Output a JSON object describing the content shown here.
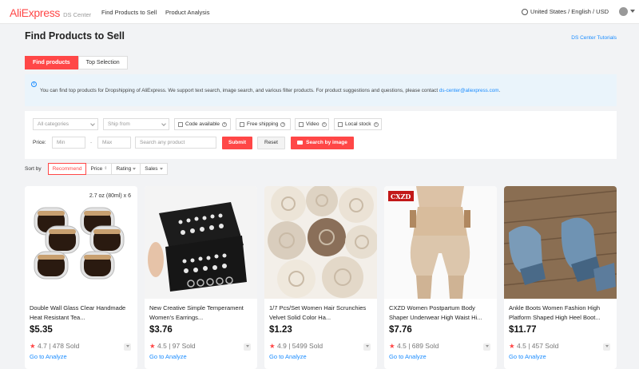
{
  "header": {
    "logo": "AliExpress",
    "logo_sub": "DS Center",
    "nav": [
      "Find Products to Sell",
      "Product Analysis"
    ],
    "locale": "United States / English / USD"
  },
  "page": {
    "title": "Find Products to Sell",
    "tutorials": "DS Center Tutorials"
  },
  "tabs": [
    {
      "label": "Find products",
      "active": true
    },
    {
      "label": "Top Selection",
      "active": false
    }
  ],
  "notice": {
    "text": "You can find top products for Dropshipping of AliExpress. We support text search, image search, and various filter products. For product suggestions and questions, please contact ",
    "email": "ds-center@aliexpress.com",
    "tail": "."
  },
  "filters": {
    "category_placeholder": "All categories",
    "ship_from_placeholder": "Ship from",
    "checkboxes": [
      "Code available",
      "Free shipping",
      "Video",
      "Local stock"
    ],
    "price_label": "Price:",
    "min_placeholder": "Min",
    "dash": "-",
    "max_placeholder": "Max",
    "search_placeholder": "Search any product",
    "submit": "Submit",
    "reset": "Reset",
    "image_search": "Search by image"
  },
  "sort": {
    "label": "Sort by",
    "options": [
      "Recommend",
      "Price",
      "Rating",
      "Sales"
    ]
  },
  "products": [
    {
      "title": "Double Wall Glass Clear Handmade Heat Resistant Tea...",
      "price": "$5.35",
      "rating": "4.7",
      "sold": "478 Sold",
      "link": "Go to Analyze",
      "badge": "2.7 oz (80ml) x 6"
    },
    {
      "title": "New Creative Simple Temperament Women's Earrings...",
      "price": "$3.76",
      "rating": "4.5",
      "sold": "97 Sold",
      "link": "Go to Analyze"
    },
    {
      "title": "1/7 Pcs/Set Women Hair Scrunchies Velvet Solid Color Ha...",
      "price": "$1.23",
      "rating": "4.9",
      "sold": "5499 Sold",
      "link": "Go to Analyze"
    },
    {
      "title": "CXZD Women Postpartum Body Shaper Underwear High Waist Hi...",
      "price": "$7.76",
      "rating": "4.5",
      "sold": "689 Sold",
      "link": "Go to Analyze",
      "badge": "CXZD"
    },
    {
      "title": "Ankle Boots Women Fashion High Platform Shaped High Heel Boot...",
      "price": "$11.77",
      "rating": "4.5",
      "sold": "457 Sold",
      "link": "Go to Analyze"
    }
  ],
  "colors": {
    "accent": "#ff4747",
    "link": "#1a8cff"
  }
}
